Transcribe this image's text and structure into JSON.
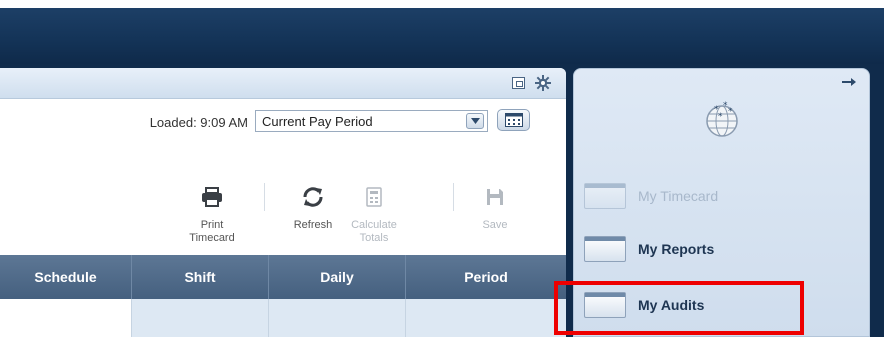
{
  "caption": "",
  "timecard": {
    "loaded_label": "Loaded: 9:09 AM",
    "period_select": {
      "selected": "Current Pay Period"
    },
    "toolbar": [
      {
        "name": "print",
        "icon": "printer-icon",
        "label": "Print Timecard",
        "enabled": true
      },
      {
        "name": "refresh",
        "icon": "refresh-icon",
        "label": "Refresh",
        "enabled": true
      },
      {
        "name": "calculate-totals",
        "icon": "calculator-icon",
        "label": "Calculate Totals",
        "enabled": false
      },
      {
        "name": "save",
        "icon": "save-icon",
        "label": "Save",
        "enabled": false
      }
    ],
    "columns": [
      "Schedule",
      "Shift",
      "Daily",
      "Period"
    ]
  },
  "widgets": {
    "items": [
      {
        "label": "My Timecard",
        "dimmed": true
      },
      {
        "label": "My Reports",
        "dimmed": false
      },
      {
        "label": "My Audits",
        "dimmed": false,
        "highlighted": true
      }
    ]
  },
  "colors": {
    "highlight": "#ee0000",
    "grid_header": "#516b89",
    "banner": "#143458"
  }
}
